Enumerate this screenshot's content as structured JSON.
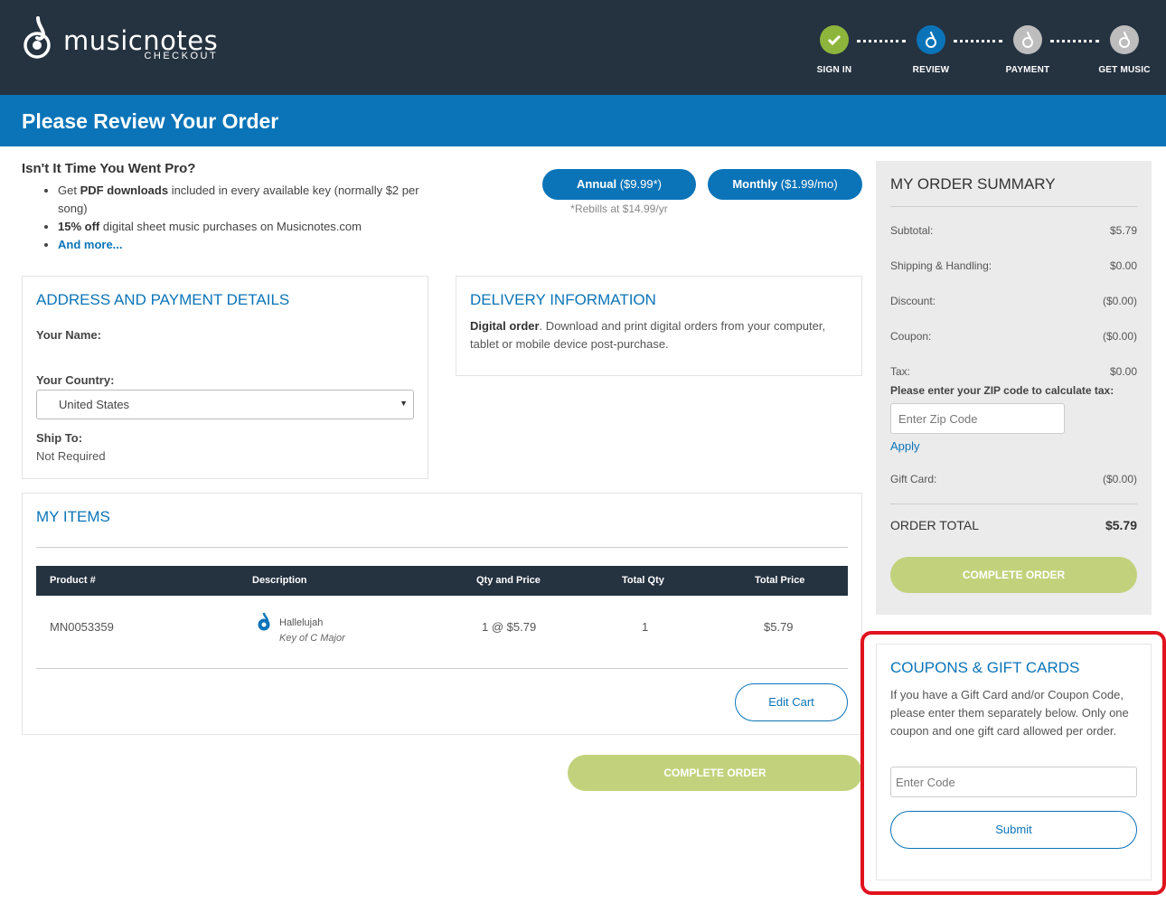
{
  "header": {
    "logo_text": "musicnotes",
    "logo_sub": "CHECKOUT",
    "steps": [
      {
        "label": "SIGN IN",
        "state": "done",
        "color": "#8db53c"
      },
      {
        "label": "REVIEW",
        "state": "current",
        "color": "#0b74b8"
      },
      {
        "label": "PAYMENT",
        "state": "todo",
        "color": "#bdbdbd"
      },
      {
        "label": "GET MUSIC",
        "state": "todo",
        "color": "#bdbdbd"
      }
    ]
  },
  "page": {
    "title": "Please Review Your Order"
  },
  "pro": {
    "heading": "Isn't It Time You Went Pro?",
    "bullet1_pre": "Get ",
    "bullet1_bold": "PDF downloads",
    "bullet1_post": " included in every available key (normally $2 per song)",
    "bullet2_bold": "15% off",
    "bullet2_post": " digital sheet music purchases on Musicnotes.com",
    "bullet3_link": "And more...",
    "annual_bold": "Annual",
    "annual_price": " ($9.99*)",
    "monthly_bold": "Monthly",
    "monthly_price": " ($1.99/mo)",
    "rebill_note": "*Rebills at $14.99/yr"
  },
  "address": {
    "heading": "ADDRESS AND PAYMENT DETAILS",
    "name_label": "Your Name:",
    "country_label": "Your Country:",
    "country_value": "United States",
    "ship_label": "Ship To:",
    "ship_value": "Not Required"
  },
  "delivery": {
    "heading": "DELIVERY INFORMATION",
    "text_bold": "Digital order",
    "text_rest": ". Download and print digital orders from your computer, tablet or mobile device post-purchase."
  },
  "items": {
    "heading": "MY ITEMS",
    "columns": [
      "Product #",
      "Description",
      "Qty and Price",
      "Total Qty",
      "Total Price"
    ],
    "rows": [
      {
        "product": "MN0053359",
        "title": "Hallelujah",
        "key": "Key of C Major",
        "qty_price": "1 @ $5.79",
        "total_qty": "1",
        "total_price": "$5.79"
      }
    ],
    "edit_cart": "Edit Cart",
    "complete_order": "COMPLETE ORDER"
  },
  "summary": {
    "heading": "MY ORDER SUMMARY",
    "subtotal_label": "Subtotal:",
    "subtotal": "$5.79",
    "shipping_label": "Shipping & Handling:",
    "shipping": "$0.00",
    "discount_label": "Discount:",
    "discount": "($0.00)",
    "coupon_label": "Coupon:",
    "coupon": "($0.00)",
    "tax_label": "Tax:",
    "tax": "$0.00",
    "zip_prompt": "Please enter your ZIP code to calculate tax:",
    "zip_placeholder": "Enter Zip Code",
    "apply": "Apply",
    "giftcard_label": "Gift Card:",
    "giftcard": "($0.00)",
    "total_label": "ORDER TOTAL",
    "total": "$5.79",
    "complete_order": "COMPLETE ORDER"
  },
  "coupons": {
    "heading": "COUPONS & GIFT CARDS",
    "text": "If you have a Gift Card and/or Coupon Code, please enter them separately below. Only one coupon and one gift card allowed per order.",
    "placeholder": "Enter Code",
    "submit": "Submit"
  },
  "colors": {
    "header_bg": "#253240",
    "brand_blue": "#0b74b8",
    "complete_green": "#c2d27c",
    "highlight_red": "#e0131f"
  }
}
